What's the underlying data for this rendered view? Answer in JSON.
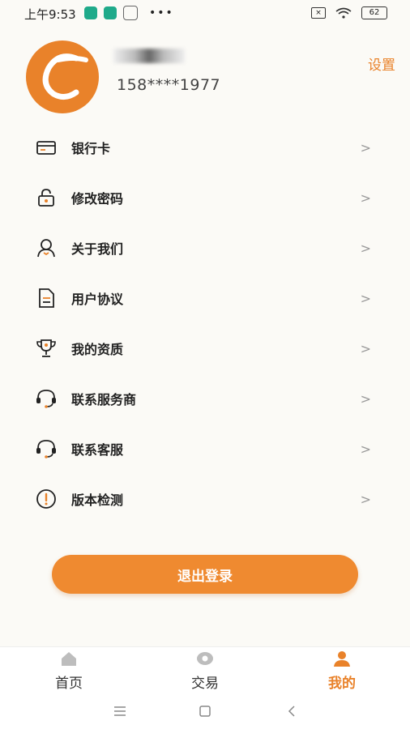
{
  "status_bar": {
    "time": "上午9:53",
    "battery": "62",
    "sim_label": "×"
  },
  "profile": {
    "phone": "158****1977",
    "settings_label": "设置"
  },
  "menu": {
    "items": [
      {
        "label": "银行卡",
        "icon": "bank-card-icon"
      },
      {
        "label": "修改密码",
        "icon": "lock-icon"
      },
      {
        "label": "关于我们",
        "icon": "user-icon"
      },
      {
        "label": "用户协议",
        "icon": "document-icon"
      },
      {
        "label": "我的资质",
        "icon": "trophy-icon"
      },
      {
        "label": "联系服务商",
        "icon": "headset-icon"
      },
      {
        "label": "联系客服",
        "icon": "headset-icon"
      },
      {
        "label": "版本检测",
        "icon": "alert-icon"
      }
    ],
    "chevron": ">"
  },
  "logout": {
    "label": "退出登录"
  },
  "tabbar": {
    "tabs": [
      {
        "label": "首页",
        "icon": "home-icon"
      },
      {
        "label": "交易",
        "icon": "eye-icon"
      },
      {
        "label": "我的",
        "icon": "person-icon",
        "active": true
      }
    ]
  },
  "colors": {
    "accent": "#e9822a",
    "button": "#ef8a30"
  }
}
